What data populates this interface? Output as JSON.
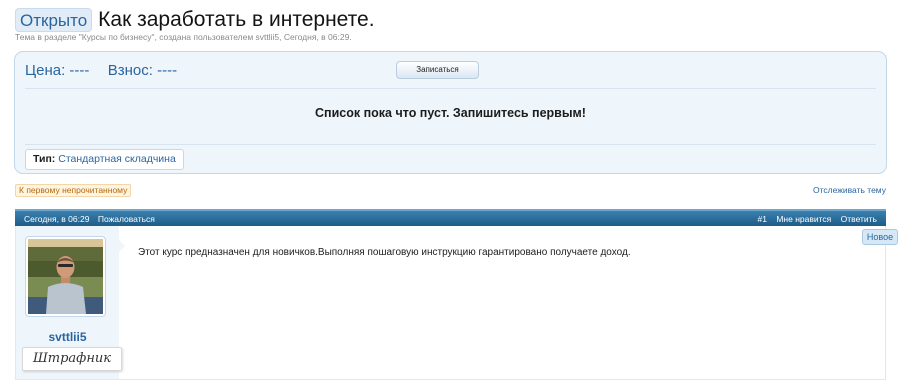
{
  "thread": {
    "prefix": "Открыто",
    "title": "Как заработать в интернете.",
    "meta": "Тема в разделе \"Курсы по бизнесу\", создана пользователем svttlii5, Сегодня, в 06:29."
  },
  "skladchina": {
    "price_label": "Цена:",
    "price_value": "----",
    "fee_label": "Взнос:",
    "fee_value": "----",
    "join_button": "Записаться",
    "empty_message": "Список пока что пуст. Запишитесь первым!",
    "type_label": "Тип:",
    "type_value": "Стандартная складчина"
  },
  "links": {
    "first_unread": "К первому непрочитанному",
    "watch_thread": "Отслеживать тему"
  },
  "post": {
    "date": "Сегодня, в 06:29",
    "report": "Пожаловаться",
    "number": "#1",
    "like": "Мне нравится",
    "reply": "Ответить",
    "new_badge": "Новое",
    "username": "svttlii5",
    "user_title": "Штрафник",
    "message": "Этот курс предназначен для новичков.Выполняя пошаговую инструкцию гарантировано получаете доход."
  },
  "colors": {
    "accent": "#2b65a0",
    "bar": "#2a6e9c",
    "panel_bg": "#eef5fb"
  }
}
